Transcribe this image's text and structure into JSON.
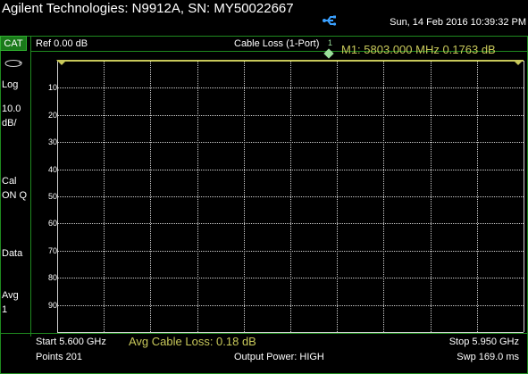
{
  "titlebar": {
    "title": "Agilent Technologies: N9912A, SN: MY50022667",
    "datetime": "Sun, 14 Feb 2016 10:39:32 PM",
    "usb_icon": "usb-icon"
  },
  "sidebar": {
    "mode_badge": "CAT",
    "cycle_icon": "cycle-icon",
    "scale_type": "Log",
    "scale_value": "10.0",
    "scale_unit": "dB/",
    "cal_label": "Cal",
    "cal_status": "ON Q",
    "data_label": "Data",
    "avg_label": "Avg",
    "avg_value": "1"
  },
  "header": {
    "ref_level": "Ref 0.00 dB",
    "measurement": "Cable Loss (1-Port)",
    "marker_readout": "M1:  5803.000 MHz  0.1763 dB",
    "marker_number": "1"
  },
  "plot": {
    "y_ticks": [
      "10",
      "20",
      "30",
      "40",
      "50",
      "60",
      "70",
      "80",
      "90"
    ],
    "trace_color": "#c8c85a",
    "grid_color": "#cfcfcf"
  },
  "footer": {
    "start": "Start 5.600 GHz",
    "avg_cable_loss": "Avg Cable Loss: 0.18 dB",
    "stop": "Stop 5.950 GHz",
    "points": "Points 201",
    "output_power": "Output Power: HIGH",
    "sweep": "Swp 169.0 ms"
  }
}
